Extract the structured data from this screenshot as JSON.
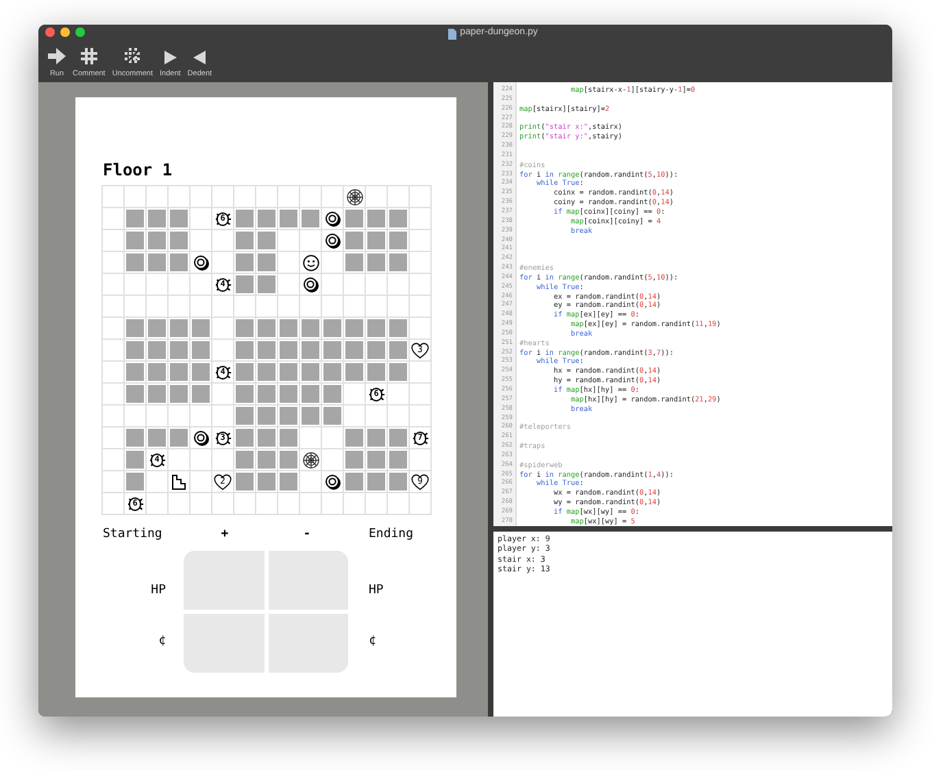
{
  "window": {
    "title": "paper-dungeon.py"
  },
  "toolbar": [
    {
      "label": "Run",
      "kind": "run"
    },
    {
      "label": "Comment",
      "kind": "comment"
    },
    {
      "label": "Uncomment",
      "kind": "uncomment"
    },
    {
      "label": "Indent",
      "kind": "indent"
    },
    {
      "label": "Dedent",
      "kind": "dedent"
    }
  ],
  "paper": {
    "title": "Floor 1",
    "grid": [
      {
        "cells": [
          {
            "kind": "floor"
          },
          {
            "kind": "floor"
          },
          {
            "kind": "floor"
          },
          {
            "kind": "floor"
          },
          {
            "kind": "floor"
          },
          {
            "kind": "floor"
          },
          {
            "kind": "floor"
          },
          {
            "kind": "floor"
          },
          {
            "kind": "floor"
          },
          {
            "kind": "floor"
          },
          {
            "kind": "floor"
          },
          {
            "kind": "web"
          },
          {
            "kind": "floor"
          },
          {
            "kind": "floor"
          },
          {
            "kind": "floor"
          }
        ]
      },
      {
        "cells": [
          {
            "kind": "floor"
          },
          {
            "kind": "wall"
          },
          {
            "kind": "wall"
          },
          {
            "kind": "wall"
          },
          {
            "kind": "floor"
          },
          {
            "kind": "enemy",
            "number": "6"
          },
          {
            "kind": "wall"
          },
          {
            "kind": "wall"
          },
          {
            "kind": "wall"
          },
          {
            "kind": "wall"
          },
          {
            "kind": "coin"
          },
          {
            "kind": "wall"
          },
          {
            "kind": "wall"
          },
          {
            "kind": "wall"
          },
          {
            "kind": "floor"
          }
        ]
      },
      {
        "cells": [
          {
            "kind": "floor"
          },
          {
            "kind": "wall"
          },
          {
            "kind": "wall"
          },
          {
            "kind": "wall"
          },
          {
            "kind": "floor"
          },
          {
            "kind": "floor"
          },
          {
            "kind": "wall"
          },
          {
            "kind": "wall"
          },
          {
            "kind": "floor"
          },
          {
            "kind": "floor"
          },
          {
            "kind": "coin"
          },
          {
            "kind": "wall"
          },
          {
            "kind": "wall"
          },
          {
            "kind": "wall"
          },
          {
            "kind": "floor"
          }
        ]
      },
      {
        "cells": [
          {
            "kind": "floor"
          },
          {
            "kind": "wall"
          },
          {
            "kind": "wall"
          },
          {
            "kind": "wall"
          },
          {
            "kind": "coin"
          },
          {
            "kind": "floor"
          },
          {
            "kind": "wall"
          },
          {
            "kind": "wall"
          },
          {
            "kind": "floor"
          },
          {
            "kind": "player"
          },
          {
            "kind": "floor"
          },
          {
            "kind": "wall"
          },
          {
            "kind": "wall"
          },
          {
            "kind": "wall"
          },
          {
            "kind": "floor"
          }
        ]
      },
      {
        "cells": [
          {
            "kind": "floor"
          },
          {
            "kind": "floor"
          },
          {
            "kind": "floor"
          },
          {
            "kind": "floor"
          },
          {
            "kind": "floor"
          },
          {
            "kind": "enemy",
            "number": "4"
          },
          {
            "kind": "wall"
          },
          {
            "kind": "wall"
          },
          {
            "kind": "floor"
          },
          {
            "kind": "coin"
          },
          {
            "kind": "floor"
          },
          {
            "kind": "floor"
          },
          {
            "kind": "floor"
          },
          {
            "kind": "floor"
          },
          {
            "kind": "floor"
          }
        ]
      },
      {
        "cells": [
          {
            "kind": "floor"
          },
          {
            "kind": "floor"
          },
          {
            "kind": "floor"
          },
          {
            "kind": "floor"
          },
          {
            "kind": "floor"
          },
          {
            "kind": "floor"
          },
          {
            "kind": "floor"
          },
          {
            "kind": "floor"
          },
          {
            "kind": "floor"
          },
          {
            "kind": "floor"
          },
          {
            "kind": "floor"
          },
          {
            "kind": "floor"
          },
          {
            "kind": "floor"
          },
          {
            "kind": "floor"
          },
          {
            "kind": "floor"
          }
        ]
      },
      {
        "cells": [
          {
            "kind": "floor"
          },
          {
            "kind": "wall"
          },
          {
            "kind": "wall"
          },
          {
            "kind": "wall"
          },
          {
            "kind": "wall"
          },
          {
            "kind": "floor"
          },
          {
            "kind": "wall"
          },
          {
            "kind": "wall"
          },
          {
            "kind": "wall"
          },
          {
            "kind": "wall"
          },
          {
            "kind": "wall"
          },
          {
            "kind": "wall"
          },
          {
            "kind": "wall"
          },
          {
            "kind": "wall"
          },
          {
            "kind": "floor"
          }
        ]
      },
      {
        "cells": [
          {
            "kind": "floor"
          },
          {
            "kind": "wall"
          },
          {
            "kind": "wall"
          },
          {
            "kind": "wall"
          },
          {
            "kind": "wall"
          },
          {
            "kind": "floor"
          },
          {
            "kind": "wall"
          },
          {
            "kind": "wall"
          },
          {
            "kind": "wall"
          },
          {
            "kind": "wall"
          },
          {
            "kind": "wall"
          },
          {
            "kind": "wall"
          },
          {
            "kind": "wall"
          },
          {
            "kind": "wall"
          },
          {
            "kind": "heart",
            "number": "3"
          }
        ]
      },
      {
        "cells": [
          {
            "kind": "floor"
          },
          {
            "kind": "wall"
          },
          {
            "kind": "wall"
          },
          {
            "kind": "wall"
          },
          {
            "kind": "wall"
          },
          {
            "kind": "enemy",
            "number": "4"
          },
          {
            "kind": "wall"
          },
          {
            "kind": "wall"
          },
          {
            "kind": "wall"
          },
          {
            "kind": "wall"
          },
          {
            "kind": "wall"
          },
          {
            "kind": "wall"
          },
          {
            "kind": "wall"
          },
          {
            "kind": "wall"
          },
          {
            "kind": "floor"
          }
        ]
      },
      {
        "cells": [
          {
            "kind": "floor"
          },
          {
            "kind": "wall"
          },
          {
            "kind": "wall"
          },
          {
            "kind": "wall"
          },
          {
            "kind": "wall"
          },
          {
            "kind": "floor"
          },
          {
            "kind": "wall"
          },
          {
            "kind": "wall"
          },
          {
            "kind": "wall"
          },
          {
            "kind": "wall"
          },
          {
            "kind": "wall"
          },
          {
            "kind": "floor"
          },
          {
            "kind": "enemy",
            "number": "6"
          },
          {
            "kind": "floor"
          },
          {
            "kind": "floor"
          }
        ]
      },
      {
        "cells": [
          {
            "kind": "floor"
          },
          {
            "kind": "floor"
          },
          {
            "kind": "floor"
          },
          {
            "kind": "floor"
          },
          {
            "kind": "floor"
          },
          {
            "kind": "floor"
          },
          {
            "kind": "wall"
          },
          {
            "kind": "wall"
          },
          {
            "kind": "wall"
          },
          {
            "kind": "wall"
          },
          {
            "kind": "wall"
          },
          {
            "kind": "floor"
          },
          {
            "kind": "floor"
          },
          {
            "kind": "floor"
          },
          {
            "kind": "floor"
          }
        ]
      },
      {
        "cells": [
          {
            "kind": "floor"
          },
          {
            "kind": "wall"
          },
          {
            "kind": "wall"
          },
          {
            "kind": "wall"
          },
          {
            "kind": "coin"
          },
          {
            "kind": "enemy",
            "number": "3"
          },
          {
            "kind": "wall"
          },
          {
            "kind": "wall"
          },
          {
            "kind": "wall"
          },
          {
            "kind": "floor"
          },
          {
            "kind": "floor"
          },
          {
            "kind": "wall"
          },
          {
            "kind": "wall"
          },
          {
            "kind": "wall"
          },
          {
            "kind": "enemy",
            "number": "7"
          }
        ]
      },
      {
        "cells": [
          {
            "kind": "floor"
          },
          {
            "kind": "wall"
          },
          {
            "kind": "enemy",
            "number": "4"
          },
          {
            "kind": "floor"
          },
          {
            "kind": "floor"
          },
          {
            "kind": "floor"
          },
          {
            "kind": "wall"
          },
          {
            "kind": "wall"
          },
          {
            "kind": "wall"
          },
          {
            "kind": "web"
          },
          {
            "kind": "floor"
          },
          {
            "kind": "wall"
          },
          {
            "kind": "wall"
          },
          {
            "kind": "wall"
          },
          {
            "kind": "floor"
          }
        ]
      },
      {
        "cells": [
          {
            "kind": "floor"
          },
          {
            "kind": "wall"
          },
          {
            "kind": "floor"
          },
          {
            "kind": "stairs"
          },
          {
            "kind": "floor"
          },
          {
            "kind": "heart",
            "number": "2"
          },
          {
            "kind": "wall"
          },
          {
            "kind": "wall"
          },
          {
            "kind": "wall"
          },
          {
            "kind": "floor"
          },
          {
            "kind": "coin"
          },
          {
            "kind": "wall"
          },
          {
            "kind": "wall"
          },
          {
            "kind": "wall"
          },
          {
            "kind": "heart",
            "number": "9"
          }
        ]
      },
      {
        "cells": [
          {
            "kind": "floor"
          },
          {
            "kind": "enemy",
            "number": "6"
          },
          {
            "kind": "floor"
          },
          {
            "kind": "floor"
          },
          {
            "kind": "floor"
          },
          {
            "kind": "floor"
          },
          {
            "kind": "floor"
          },
          {
            "kind": "floor"
          },
          {
            "kind": "floor"
          },
          {
            "kind": "floor"
          },
          {
            "kind": "floor"
          },
          {
            "kind": "floor"
          },
          {
            "kind": "floor"
          },
          {
            "kind": "floor"
          },
          {
            "kind": "floor"
          }
        ]
      }
    ],
    "stats": {
      "starting": "Starting",
      "plus": "+",
      "minus": "-",
      "ending": "Ending",
      "left_rows": [
        "HP",
        "¢"
      ],
      "right_rows": [
        "HP",
        "¢"
      ]
    }
  },
  "editor": {
    "lines": [
      {
        "n": "224",
        "segs": [
          {
            "kind": "fn",
            "text": "            map"
          },
          {
            "kind": "p",
            "text": "[stairx-x-"
          },
          {
            "kind": "num",
            "text": "1"
          },
          {
            "kind": "p",
            "text": "][stairy-y-"
          },
          {
            "kind": "num",
            "text": "1"
          },
          {
            "kind": "p",
            "text": "]="
          },
          {
            "kind": "num",
            "text": "0"
          }
        ]
      },
      {
        "n": "225"
      },
      {
        "n": "226",
        "segs": [
          {
            "kind": "fn",
            "text": "map"
          },
          {
            "kind": "p",
            "text": "[stairx][stairy]="
          },
          {
            "kind": "num",
            "text": "2"
          }
        ]
      },
      {
        "n": "227"
      },
      {
        "n": "228",
        "segs": [
          {
            "kind": "fn",
            "text": "print"
          },
          {
            "kind": "p",
            "text": "("
          },
          {
            "kind": "str",
            "text": "\"stair x:\""
          },
          {
            "kind": "p",
            "text": ",stairx)"
          }
        ]
      },
      {
        "n": "229",
        "segs": [
          {
            "kind": "fn",
            "text": "print"
          },
          {
            "kind": "p",
            "text": "("
          },
          {
            "kind": "str",
            "text": "\"stair y:\""
          },
          {
            "kind": "p",
            "text": ",stairy)"
          }
        ]
      },
      {
        "n": "230"
      },
      {
        "n": "231"
      },
      {
        "n": "232",
        "segs": [
          {
            "kind": "com",
            "text": "#coins"
          }
        ]
      },
      {
        "n": "233",
        "segs": [
          {
            "kind": "kw",
            "text": "for"
          },
          {
            "kind": "p",
            "text": " i "
          },
          {
            "kind": "kw",
            "text": "in"
          },
          {
            "kind": "fn",
            "text": " range"
          },
          {
            "kind": "p",
            "text": "(random.randint("
          },
          {
            "kind": "num",
            "text": "5"
          },
          {
            "kind": "p",
            "text": ","
          },
          {
            "kind": "num",
            "text": "10"
          },
          {
            "kind": "p",
            "text": ")):"
          }
        ]
      },
      {
        "n": "234",
        "segs": [
          {
            "kind": "kw",
            "text": "    while"
          },
          {
            "kind": "kw",
            "text": " True"
          },
          {
            "kind": "p",
            "text": ":"
          }
        ]
      },
      {
        "n": "235",
        "segs": [
          {
            "kind": "p",
            "text": "        coinx = random.randint("
          },
          {
            "kind": "num",
            "text": "0"
          },
          {
            "kind": "p",
            "text": ","
          },
          {
            "kind": "num",
            "text": "14"
          },
          {
            "kind": "p",
            "text": ")"
          }
        ]
      },
      {
        "n": "236",
        "segs": [
          {
            "kind": "p",
            "text": "        coiny = random.randint("
          },
          {
            "kind": "num",
            "text": "0"
          },
          {
            "kind": "p",
            "text": ","
          },
          {
            "kind": "num",
            "text": "14"
          },
          {
            "kind": "p",
            "text": ")"
          }
        ]
      },
      {
        "n": "237",
        "segs": [
          {
            "kind": "kw",
            "text": "        if"
          },
          {
            "kind": "fn",
            "text": " map"
          },
          {
            "kind": "p",
            "text": "[coinx][coiny] == "
          },
          {
            "kind": "num",
            "text": "0"
          },
          {
            "kind": "p",
            "text": ":"
          }
        ]
      },
      {
        "n": "238",
        "segs": [
          {
            "kind": "fn",
            "text": "            map"
          },
          {
            "kind": "p",
            "text": "[coinx][coiny] = "
          },
          {
            "kind": "num",
            "text": "4"
          }
        ]
      },
      {
        "n": "239",
        "segs": [
          {
            "kind": "kw",
            "text": "            break"
          }
        ]
      },
      {
        "n": "240"
      },
      {
        "n": "241"
      },
      {
        "n": "242"
      },
      {
        "n": "243",
        "segs": [
          {
            "kind": "com",
            "text": "#enemies"
          }
        ]
      },
      {
        "n": "244",
        "segs": [
          {
            "kind": "kw",
            "text": "for"
          },
          {
            "kind": "p",
            "text": " i "
          },
          {
            "kind": "kw",
            "text": "in"
          },
          {
            "kind": "fn",
            "text": " range"
          },
          {
            "kind": "p",
            "text": "(random.randint("
          },
          {
            "kind": "num",
            "text": "5"
          },
          {
            "kind": "p",
            "text": ","
          },
          {
            "kind": "num",
            "text": "10"
          },
          {
            "kind": "p",
            "text": ")):"
          }
        ]
      },
      {
        "n": "245",
        "segs": [
          {
            "kind": "kw",
            "text": "    while"
          },
          {
            "kind": "kw",
            "text": " True"
          },
          {
            "kind": "p",
            "text": ":"
          }
        ]
      },
      {
        "n": "246",
        "segs": [
          {
            "kind": "p",
            "text": "        ex = random.randint("
          },
          {
            "kind": "num",
            "text": "0"
          },
          {
            "kind": "p",
            "text": ","
          },
          {
            "kind": "num",
            "text": "14"
          },
          {
            "kind": "p",
            "text": ")"
          }
        ]
      },
      {
        "n": "247",
        "segs": [
          {
            "kind": "p",
            "text": "        ey = random.randint("
          },
          {
            "kind": "num",
            "text": "0"
          },
          {
            "kind": "p",
            "text": ","
          },
          {
            "kind": "num",
            "text": "14"
          },
          {
            "kind": "p",
            "text": ")"
          }
        ]
      },
      {
        "n": "248",
        "segs": [
          {
            "kind": "kw",
            "text": "        if"
          },
          {
            "kind": "fn",
            "text": " map"
          },
          {
            "kind": "p",
            "text": "[ex][ey] == "
          },
          {
            "kind": "num",
            "text": "0"
          },
          {
            "kind": "p",
            "text": ":"
          }
        ]
      },
      {
        "n": "249",
        "segs": [
          {
            "kind": "fn",
            "text": "            map"
          },
          {
            "kind": "p",
            "text": "[ex][ey] = random.randint("
          },
          {
            "kind": "num",
            "text": "11"
          },
          {
            "kind": "p",
            "text": ","
          },
          {
            "kind": "num",
            "text": "19"
          },
          {
            "kind": "p",
            "text": ")"
          }
        ]
      },
      {
        "n": "250",
        "segs": [
          {
            "kind": "kw",
            "text": "            break"
          }
        ]
      },
      {
        "n": "251",
        "segs": [
          {
            "kind": "com",
            "text": "#hearts"
          }
        ]
      },
      {
        "n": "252",
        "segs": [
          {
            "kind": "kw",
            "text": "for"
          },
          {
            "kind": "p",
            "text": " i "
          },
          {
            "kind": "kw",
            "text": "in"
          },
          {
            "kind": "fn",
            "text": " range"
          },
          {
            "kind": "p",
            "text": "(random.randint("
          },
          {
            "kind": "num",
            "text": "3"
          },
          {
            "kind": "p",
            "text": ","
          },
          {
            "kind": "num",
            "text": "7"
          },
          {
            "kind": "p",
            "text": ")):"
          }
        ]
      },
      {
        "n": "253",
        "segs": [
          {
            "kind": "kw",
            "text": "    while"
          },
          {
            "kind": "kw",
            "text": " True"
          },
          {
            "kind": "p",
            "text": ":"
          }
        ]
      },
      {
        "n": "254",
        "segs": [
          {
            "kind": "p",
            "text": "        hx = random.randint("
          },
          {
            "kind": "num",
            "text": "0"
          },
          {
            "kind": "p",
            "text": ","
          },
          {
            "kind": "num",
            "text": "14"
          },
          {
            "kind": "p",
            "text": ")"
          }
        ]
      },
      {
        "n": "255",
        "segs": [
          {
            "kind": "p",
            "text": "        hy = random.randint("
          },
          {
            "kind": "num",
            "text": "0"
          },
          {
            "kind": "p",
            "text": ","
          },
          {
            "kind": "num",
            "text": "14"
          },
          {
            "kind": "p",
            "text": ")"
          }
        ]
      },
      {
        "n": "256",
        "segs": [
          {
            "kind": "kw",
            "text": "        if"
          },
          {
            "kind": "fn",
            "text": " map"
          },
          {
            "kind": "p",
            "text": "[hx][hy] == "
          },
          {
            "kind": "num",
            "text": "0"
          },
          {
            "kind": "p",
            "text": ":"
          }
        ]
      },
      {
        "n": "257",
        "segs": [
          {
            "kind": "fn",
            "text": "            map"
          },
          {
            "kind": "p",
            "text": "[hx][hy] = random.randint("
          },
          {
            "kind": "num",
            "text": "21"
          },
          {
            "kind": "p",
            "text": ","
          },
          {
            "kind": "num",
            "text": "29"
          },
          {
            "kind": "p",
            "text": ")"
          }
        ]
      },
      {
        "n": "258",
        "segs": [
          {
            "kind": "kw",
            "text": "            break"
          }
        ]
      },
      {
        "n": "259"
      },
      {
        "n": "260",
        "segs": [
          {
            "kind": "com",
            "text": "#teleporters"
          }
        ]
      },
      {
        "n": "261"
      },
      {
        "n": "262",
        "segs": [
          {
            "kind": "com",
            "text": "#traps"
          }
        ]
      },
      {
        "n": "263"
      },
      {
        "n": "264",
        "segs": [
          {
            "kind": "com",
            "text": "#spiderweb"
          }
        ]
      },
      {
        "n": "265",
        "segs": [
          {
            "kind": "kw",
            "text": "for"
          },
          {
            "kind": "p",
            "text": " i "
          },
          {
            "kind": "kw",
            "text": "in"
          },
          {
            "kind": "fn",
            "text": " range"
          },
          {
            "kind": "p",
            "text": "(random.randint("
          },
          {
            "kind": "num",
            "text": "1"
          },
          {
            "kind": "p",
            "text": ","
          },
          {
            "kind": "num",
            "text": "4"
          },
          {
            "kind": "p",
            "text": ")):"
          }
        ]
      },
      {
        "n": "266",
        "segs": [
          {
            "kind": "kw",
            "text": "    while"
          },
          {
            "kind": "kw",
            "text": " True"
          },
          {
            "kind": "p",
            "text": ":"
          }
        ]
      },
      {
        "n": "267",
        "segs": [
          {
            "kind": "p",
            "text": "        wx = random.randint("
          },
          {
            "kind": "num",
            "text": "0"
          },
          {
            "kind": "p",
            "text": ","
          },
          {
            "kind": "num",
            "text": "14"
          },
          {
            "kind": "p",
            "text": ")"
          }
        ]
      },
      {
        "n": "268",
        "segs": [
          {
            "kind": "p",
            "text": "        wy = random.randint("
          },
          {
            "kind": "num",
            "text": "0"
          },
          {
            "kind": "p",
            "text": ","
          },
          {
            "kind": "num",
            "text": "14"
          },
          {
            "kind": "p",
            "text": ")"
          }
        ]
      },
      {
        "n": "269",
        "segs": [
          {
            "kind": "kw",
            "text": "        if"
          },
          {
            "kind": "fn",
            "text": " map"
          },
          {
            "kind": "p",
            "text": "[wx][wy] == "
          },
          {
            "kind": "num",
            "text": "0"
          },
          {
            "kind": "p",
            "text": ":"
          }
        ]
      },
      {
        "n": "270",
        "segs": [
          {
            "kind": "fn",
            "text": "            map"
          },
          {
            "kind": "p",
            "text": "[wx][wy] = "
          },
          {
            "kind": "num",
            "text": "5"
          }
        ]
      }
    ]
  },
  "output": {
    "lines": [
      "player x: 9",
      "player y: 3",
      "stair x: 3",
      "stair y: 13"
    ]
  }
}
